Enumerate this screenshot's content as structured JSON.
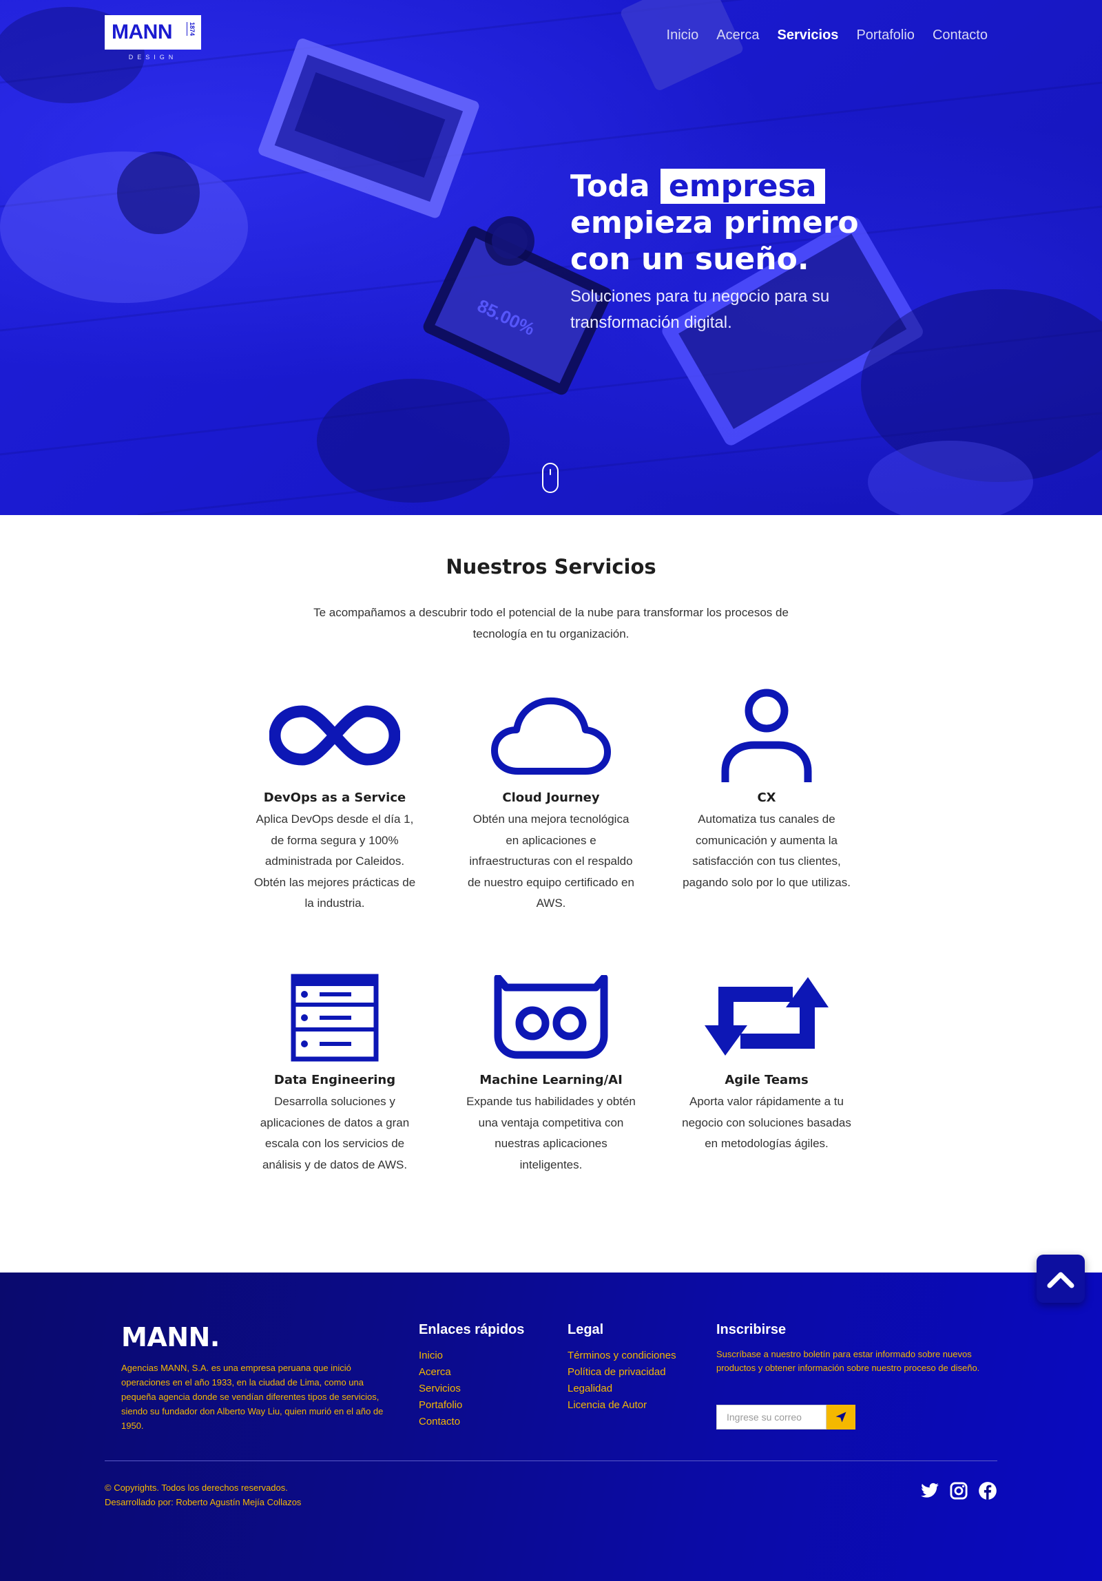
{
  "brand": {
    "logo_text": "MANN",
    "logo_year": "1874",
    "logo_sub": "DESIGN"
  },
  "nav": {
    "items": [
      {
        "label": "Inicio",
        "active": false
      },
      {
        "label": "Acerca",
        "active": false
      },
      {
        "label": "Servicios",
        "active": true
      },
      {
        "label": "Portafolio",
        "active": false
      },
      {
        "label": "Contacto",
        "active": false
      }
    ]
  },
  "hero": {
    "title_line1_a": "Toda",
    "title_line1_highlight": "empresa",
    "title_line2": "empieza primero",
    "title_line3": "con un sueño.",
    "subtitle": "Soluciones para tu negocio para su transformación digital.",
    "scroll_icon": "mouse-scroll-icon"
  },
  "services": {
    "title": "Nuestros Servicios",
    "description": "Te acompañamos a descubrir todo el potencial de la nube para transformar los procesos de tecnología en tu organización.",
    "items": [
      {
        "icon": "infinity-icon",
        "title": "DevOps as a Service",
        "text": "Aplica DevOps desde el día 1, de forma segura y 100% administrada por Caleidos. Obtén las mejores prácticas de la industria."
      },
      {
        "icon": "cloud-icon",
        "title": "Cloud Journey",
        "text": "Obtén una mejora tecnológica en aplicaciones e infraestructuras con el respaldo de nuestro equipo certificado en AWS."
      },
      {
        "icon": "user-icon",
        "title": "CX",
        "text": "Automatiza tus canales de comunicación y aumenta la satisfacción con tus clientes, pagando solo por lo que utilizas."
      },
      {
        "icon": "server-icon",
        "title": "Data Engineering",
        "text": "Desarrolla soluciones y aplicaciones de datos a gran escala con los servicios de análisis y de datos de AWS."
      },
      {
        "icon": "robot-icon",
        "title": "Machine Learning/AI",
        "text": "Expande tus habilidades y obtén una ventaja competitiva con nuestras aplicaciones inteligentes."
      },
      {
        "icon": "retweet-icon",
        "title": "Agile Teams",
        "text": "Aporta valor rápidamente a tu negocio con soluciones basadas en metodologías ágiles."
      }
    ]
  },
  "footer": {
    "brand": "MANN.",
    "about": "Agencias MANN, S.A. es una empresa peruana que inició operaciones en el año 1933, en la ciudad de Lima, como una pequeña agencia donde se vendían diferentes tipos de servicios, siendo su fundador don Alberto Way Liu, quien murió en el año de 1950.",
    "quick_links": {
      "title": "Enlaces rápidos",
      "links": [
        "Inicio",
        "Acerca",
        "Servicios",
        "Portafolio",
        "Contacto"
      ]
    },
    "legal": {
      "title": "Legal",
      "links": [
        "Términos y condiciones",
        "Política de privacidad",
        "Legalidad",
        "Licencia de Autor"
      ]
    },
    "subscribe": {
      "title": "Inscribirse",
      "text": "Suscríbase a nuestro boletín para estar informado sobre nuevos productos y obtener información sobre nuestro proceso de diseño.",
      "placeholder": "Ingrese su correo",
      "button_icon": "send-icon"
    },
    "copyright": "© Copyrights. Todos los derechos reservados.",
    "developer": "Desarrollado por: Roberto Agustín Mejía Collazos",
    "socials": [
      "twitter-icon",
      "instagram-icon",
      "facebook-icon"
    ]
  },
  "colors": {
    "hero_blue": "#1a1ad0",
    "icon_blue": "#0d17b5",
    "footer_navy": "#0b0b88",
    "accent_yellow": "#f5b800"
  }
}
